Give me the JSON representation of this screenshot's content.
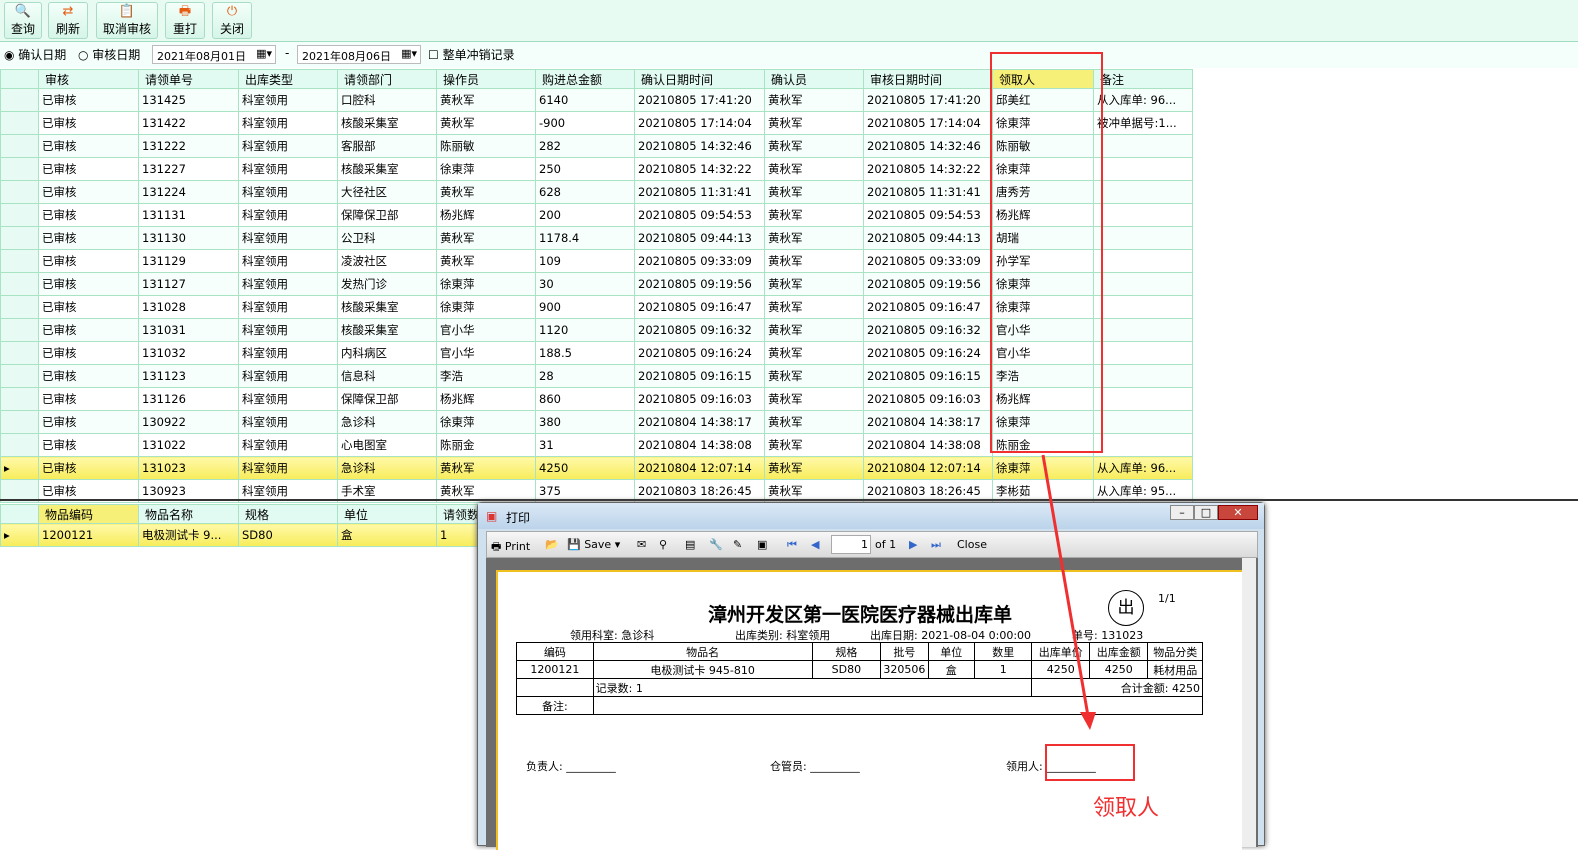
{
  "toolbar": [
    {
      "label": "查询",
      "icon": "search-icon"
    },
    {
      "label": "刷新",
      "icon": "refresh-icon"
    },
    {
      "label": "取消审核",
      "icon": "cancel-audit-icon"
    },
    {
      "label": "重打",
      "icon": "printer-icon"
    },
    {
      "label": "关闭",
      "icon": "power-icon"
    }
  ],
  "filter": {
    "confirm_date": "确认日期",
    "audit_date": "审核日期",
    "date_from": "2021年08月01日",
    "sep": "-",
    "date_to": "2021年08月06日",
    "whole_offset": "整单冲销记录"
  },
  "main_grid": {
    "columns": [
      "审核",
      "请领单号",
      "出库类型",
      "请领部门",
      "操作员",
      "购进总金额",
      "确认日期时间",
      "确认员",
      "审核日期时间",
      "领取人",
      "备注"
    ],
    "rows": [
      [
        "已审核",
        "131425",
        "科室领用",
        "口腔科",
        "黄秋军",
        "6140",
        "20210805 17:41:20",
        "黄秋军",
        "20210805 17:41:20",
        "邱美红",
        "从入库单: 96..."
      ],
      [
        "已审核",
        "131422",
        "科室领用",
        "核酸采集室",
        "黄秋军",
        "-900",
        "20210805 17:14:04",
        "黄秋军",
        "20210805 17:14:04",
        "徐東萍",
        "被冲单据号:1..."
      ],
      [
        "已审核",
        "131222",
        "科室领用",
        "客服部",
        "陈丽敏",
        "282",
        "20210805 14:32:46",
        "黄秋军",
        "20210805 14:32:46",
        "陈丽敏",
        ""
      ],
      [
        "已审核",
        "131227",
        "科室领用",
        "核酸采集室",
        "徐東萍",
        "250",
        "20210805 14:32:22",
        "黄秋军",
        "20210805 14:32:22",
        "徐東萍",
        ""
      ],
      [
        "已审核",
        "131224",
        "科室领用",
        "大径社区",
        "黄秋军",
        "628",
        "20210805 11:31:41",
        "黄秋军",
        "20210805 11:31:41",
        "唐秀芳",
        ""
      ],
      [
        "已审核",
        "131131",
        "科室领用",
        "保障保卫部",
        "杨兆辉",
        "200",
        "20210805 09:54:53",
        "黄秋军",
        "20210805 09:54:53",
        "杨兆辉",
        ""
      ],
      [
        "已审核",
        "131130",
        "科室领用",
        "公卫科",
        "黄秋军",
        "1178.4",
        "20210805 09:44:13",
        "黄秋军",
        "20210805 09:44:13",
        "胡瑞",
        ""
      ],
      [
        "已审核",
        "131129",
        "科室领用",
        "凌波社区",
        "黄秋军",
        "109",
        "20210805 09:33:09",
        "黄秋军",
        "20210805 09:33:09",
        "孙学军",
        ""
      ],
      [
        "已审核",
        "131127",
        "科室领用",
        "发热门诊",
        "徐東萍",
        "30",
        "20210805 09:19:56",
        "黄秋军",
        "20210805 09:19:56",
        "徐東萍",
        ""
      ],
      [
        "已审核",
        "131028",
        "科室领用",
        "核酸采集室",
        "徐東萍",
        "900",
        "20210805 09:16:47",
        "黄秋军",
        "20210805 09:16:47",
        "徐東萍",
        ""
      ],
      [
        "已审核",
        "131031",
        "科室领用",
        "核酸采集室",
        "官小华",
        "1120",
        "20210805 09:16:32",
        "黄秋军",
        "20210805 09:16:32",
        "官小华",
        ""
      ],
      [
        "已审核",
        "131032",
        "科室领用",
        "内科病区",
        "官小华",
        "188.5",
        "20210805 09:16:24",
        "黄秋军",
        "20210805 09:16:24",
        "官小华",
        ""
      ],
      [
        "已审核",
        "131123",
        "科室领用",
        "信息科",
        "李浩",
        "28",
        "20210805 09:16:15",
        "黄秋军",
        "20210805 09:16:15",
        "李浩",
        ""
      ],
      [
        "已审核",
        "131126",
        "科室领用",
        "保障保卫部",
        "杨兆辉",
        "860",
        "20210805 09:16:03",
        "黄秋军",
        "20210805 09:16:03",
        "杨兆辉",
        ""
      ],
      [
        "已审核",
        "130922",
        "科室领用",
        "急诊科",
        "徐東萍",
        "380",
        "20210804 14:38:17",
        "黄秋军",
        "20210804 14:38:17",
        "徐東萍",
        ""
      ],
      [
        "已审核",
        "131022",
        "科室领用",
        "心电图室",
        "陈丽金",
        "31",
        "20210804 14:38:08",
        "黄秋军",
        "20210804 14:38:08",
        "陈丽金",
        ""
      ],
      [
        "已审核",
        "131023",
        "科室领用",
        "急诊科",
        "黄秋军",
        "4250",
        "20210804 12:07:14",
        "黄秋军",
        "20210804 12:07:14",
        "徐東萍",
        "从入库单: 96..."
      ],
      [
        "已审核",
        "130923",
        "科室领用",
        "手术室",
        "黄秋军",
        "375",
        "20210803 18:26:45",
        "黄秋军",
        "20210803 18:26:45",
        "李彬茹",
        "从入库单: 95..."
      ]
    ],
    "selected_row": 16
  },
  "detail_grid": {
    "columns": [
      "物品编码",
      "物品名称",
      "规格",
      "单位",
      "请领数"
    ],
    "rows": [
      [
        "1200121",
        "电极测试卡 9...",
        "SD80",
        "盒",
        "1"
      ]
    ]
  },
  "dialog": {
    "title": "打印",
    "print": "Print",
    "save": "Save",
    "page": "1",
    "of": "of 1",
    "close": "Close",
    "report": {
      "title": "漳州开发区第一医院医疗器械出库单",
      "stamp": "出",
      "page_no": "1/1",
      "dept": "领用科室: 急诊科",
      "type": "出库类别: 科室领用",
      "date": "出库日期: 2021-08-04 0:00:00",
      "no": "单号: 131023",
      "columns": [
        "编码",
        "物品名",
        "规格",
        "批号",
        "单位",
        "数里",
        "出库单价",
        "出库金额",
        "物品分类"
      ],
      "row": [
        "1200121",
        "电极测试卡 945-810",
        "SD80",
        "320506",
        "盒",
        "1",
        "4250",
        "4250",
        "耗材用品"
      ],
      "count": "记录数: 1",
      "total": "合计金额: 4250",
      "remark": "备注:",
      "sign_head": "负责人: _________",
      "sign_keeper": "仓管员: _________",
      "sign_receiver": "领用人: _________"
    }
  },
  "annotation": {
    "label": "领取人",
    "color": "#f03030"
  }
}
